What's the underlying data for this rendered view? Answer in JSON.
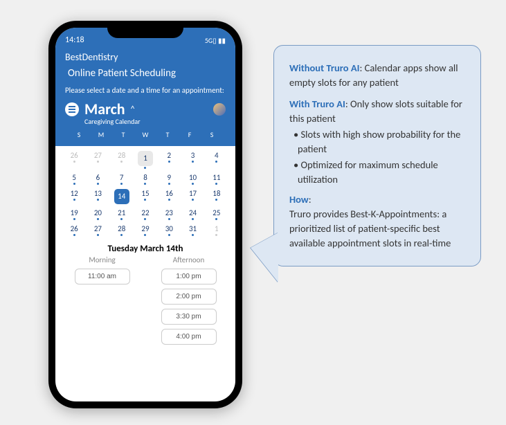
{
  "phone": {
    "status": {
      "time": "14:18",
      "signal": "5G▯ ▮▮"
    },
    "brand": "BestDentistry",
    "title": "Online Patient Scheduling",
    "instruction": "Please select a date and a time for an appointment:",
    "month": "March",
    "subtitle": "Caregiving Calendar",
    "dow": [
      "S",
      "M",
      "T",
      "W",
      "T",
      "F",
      "S"
    ],
    "weeks": [
      [
        {
          "n": "26",
          "gray": true,
          "dot": false,
          "dotgray": true
        },
        {
          "n": "27",
          "gray": true,
          "dot": false,
          "dotgray": true
        },
        {
          "n": "28",
          "gray": true,
          "dot": false,
          "dotgray": true
        },
        {
          "n": "1",
          "today": true,
          "dot": true
        },
        {
          "n": "2",
          "dot": true
        },
        {
          "n": "3",
          "dot": true
        },
        {
          "n": "4",
          "dot": true
        }
      ],
      [
        {
          "n": "5",
          "dot": true
        },
        {
          "n": "6",
          "dot": true
        },
        {
          "n": "7",
          "dot": true
        },
        {
          "n": "8",
          "dot": true
        },
        {
          "n": "9",
          "dot": true
        },
        {
          "n": "10",
          "dot": true
        },
        {
          "n": "11",
          "dot": true
        }
      ],
      [
        {
          "n": "12",
          "dot": true
        },
        {
          "n": "13",
          "dot": true
        },
        {
          "n": "14",
          "selected": true,
          "dot": false
        },
        {
          "n": "15",
          "dot": true
        },
        {
          "n": "16",
          "dot": true
        },
        {
          "n": "17",
          "dot": true
        },
        {
          "n": "18",
          "dot": true
        }
      ],
      [
        {
          "n": "19",
          "dot": true
        },
        {
          "n": "20",
          "dot": true
        },
        {
          "n": "21",
          "dot": true
        },
        {
          "n": "22",
          "dot": true
        },
        {
          "n": "23",
          "dot": true
        },
        {
          "n": "24",
          "dot": true
        },
        {
          "n": "25",
          "dot": true
        }
      ],
      [
        {
          "n": "26",
          "dot": true
        },
        {
          "n": "27",
          "dot": true
        },
        {
          "n": "28",
          "dot": true
        },
        {
          "n": "29",
          "dot": true
        },
        {
          "n": "30",
          "dot": true
        },
        {
          "n": "31",
          "dot": true
        },
        {
          "n": "1",
          "gray": true,
          "dotgray": true
        }
      ]
    ],
    "selected_date_label": "Tuesday March 14th",
    "periods": {
      "morning": {
        "label": "Morning",
        "slots": [
          "11:00 am"
        ]
      },
      "afternoon": {
        "label": "Afternoon",
        "slots": [
          "1:00 pm",
          "2:00 pm",
          "3:30 pm",
          "4:00 pm"
        ]
      }
    }
  },
  "callout": {
    "without_label": "Without Truro AI",
    "without_text": ": Calendar apps show all empty slots for any patient",
    "with_label": "With Truro AI",
    "with_text": ": Only show slots suitable for this patient",
    "with_bullets": [
      "Slots with high show probability for the patient",
      "Optimized for maximum schedule utilization"
    ],
    "how_label": "How",
    "how_text": "Truro provides Best-K-Appointments: a prioritized list of patient-specific best available appointment slots in real-time"
  }
}
